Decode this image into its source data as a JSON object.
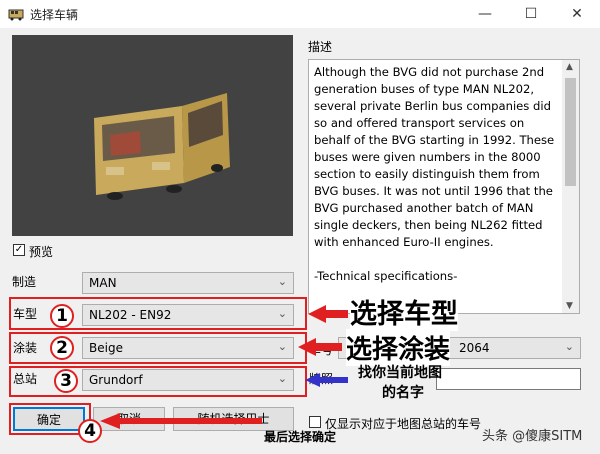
{
  "window": {
    "title": "选择车辆",
    "minimize": "—",
    "maximize": "☐",
    "close": "✕"
  },
  "preview_checkbox": {
    "label": "预览",
    "checked": true
  },
  "fields": {
    "manufacturer": {
      "label": "制造",
      "value": "MAN"
    },
    "model": {
      "label": "车型",
      "value": "NL202 - EN92"
    },
    "livery": {
      "label": "涂装",
      "value": "Beige"
    },
    "depot": {
      "label": "总站",
      "value": "Grundorf"
    },
    "vehicle_number": {
      "label": "车号",
      "value": "2064"
    },
    "plate": {
      "label": "牌照",
      "value": ""
    }
  },
  "description": {
    "label": "描述",
    "text": "Although the BVG did not purchase 2nd generation buses of type MAN NL202, several private Berlin bus companies did so and offered transport services on behalf of the BVG starting in 1992. These buses were given numbers in the 8000 section to easily distinguish them from BVG buses. It was not until 1996 that the BVG purchased another batch of MAN single deckers, then being NL262 fitted with enhanced Euro-II engines.\n\n-Technical specifications-"
  },
  "buttons": {
    "ok": "确定",
    "cancel": "取消",
    "random": "随机选择巴士"
  },
  "depot_only_checkbox": {
    "label": "仅显示对应于地图总站的车号",
    "checked": false
  },
  "annotations": {
    "step1": "1",
    "step2": "2",
    "step3": "3",
    "step4": "4",
    "select_model": "选择车型",
    "select_livery": "选择涂装",
    "find_map_name_line1": "找你当前地图",
    "find_map_name_line2": "的名字",
    "final_confirm": "最后选择确定"
  },
  "watermark": "头条 @傻康SITM",
  "colors": {
    "annotation_red": "#e02020",
    "arrow_blue": "#3333cc"
  }
}
